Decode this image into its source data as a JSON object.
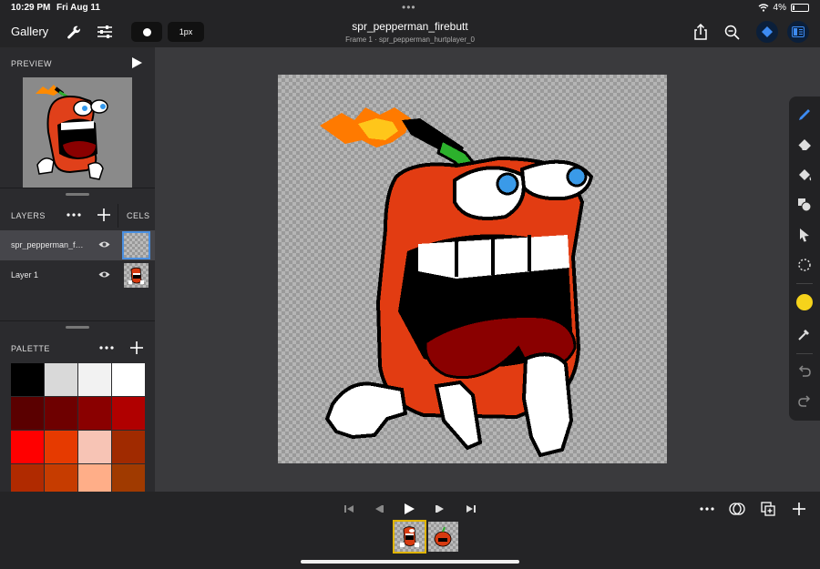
{
  "status": {
    "time": "10:29 PM",
    "date": "Fri Aug 11",
    "battery": "4%"
  },
  "toolbar": {
    "gallery_label": "Gallery",
    "brush_size_label": "1px",
    "doc_title": "spr_pepperman_firebutt",
    "doc_subtitle": "Frame 1 · spr_pepperman_hurtplayer_0"
  },
  "sidebar": {
    "preview_title": "PREVIEW",
    "layers_title": "LAYERS",
    "cels_title": "CELS",
    "layers": [
      {
        "name": "spr_pepperman_firebutt",
        "selected": true
      },
      {
        "name": "Layer 1",
        "selected": false
      }
    ],
    "palette_title": "PALETTE",
    "palette": [
      "#000000",
      "#d9d9d9",
      "#f2f2f2",
      "#ffffff",
      "#5a0000",
      "#6e0000",
      "#8a0000",
      "#b00000",
      "#ff0000",
      "#e63a00",
      "#f7c4b5",
      "#a02a00",
      "#b02a00",
      "#c63c00",
      "#ffae88",
      "#a03a00"
    ]
  },
  "colors": {
    "accent": "#4a90e2",
    "active_color": "#f6d31b",
    "frame_highlight": "#e0b400"
  },
  "icons": {
    "settings": "wrench-icon",
    "adjust": "sliders-icon",
    "share": "share-icon",
    "zoom": "zoom-icon"
  }
}
